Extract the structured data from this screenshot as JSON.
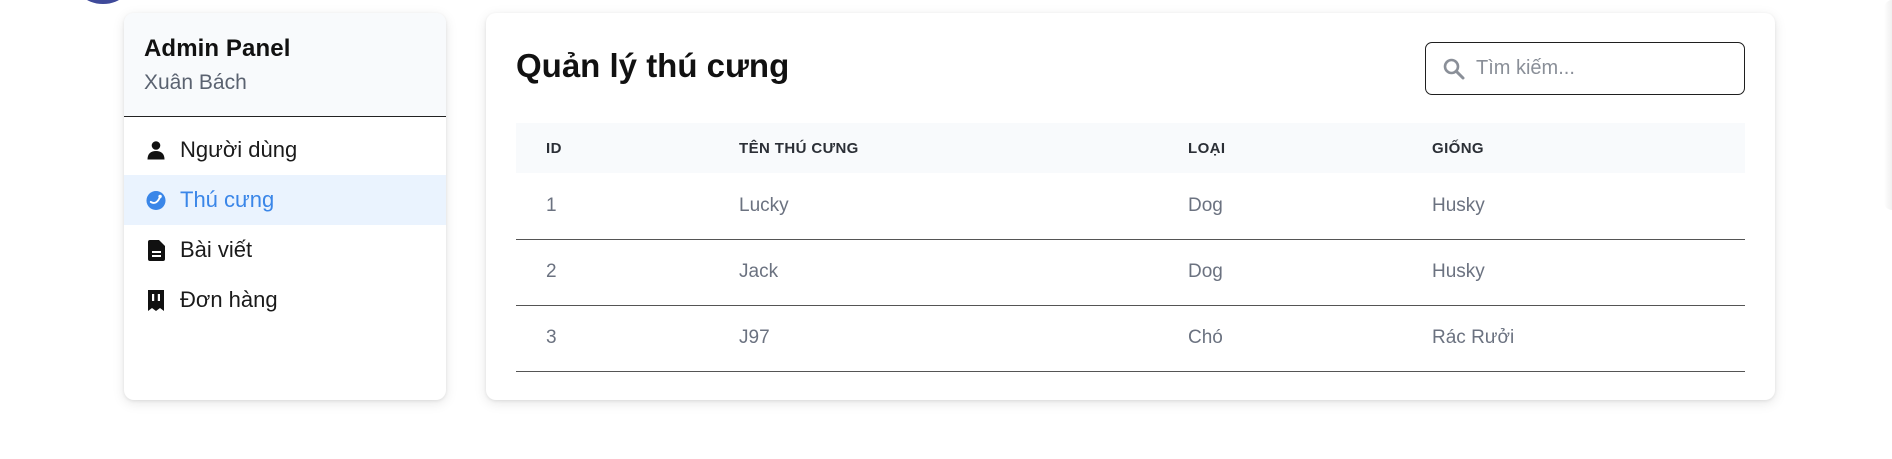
{
  "sidebar": {
    "title": "Admin Panel",
    "subtitle": "Xuân Bách",
    "items": [
      {
        "label": "Người dùng",
        "icon": "user-icon",
        "active": false
      },
      {
        "label": "Thú cưng",
        "icon": "pet-icon",
        "active": true
      },
      {
        "label": "Bài viết",
        "icon": "document-icon",
        "active": false
      },
      {
        "label": "Đơn hàng",
        "icon": "receipt-icon",
        "active": false
      }
    ]
  },
  "main": {
    "title": "Quản lý thú cưng",
    "search": {
      "placeholder": "Tìm kiếm...",
      "value": ""
    },
    "table": {
      "headers": [
        "ID",
        "TÊN THÚ CƯNG",
        "LOẠI",
        "GIỐNG"
      ],
      "rows": [
        [
          "1",
          "Lucky",
          "Dog",
          "Husky"
        ],
        [
          "2",
          "Jack",
          "Dog",
          "Husky"
        ],
        [
          "3",
          "J97",
          "Chó",
          "Rác Rưởi"
        ]
      ]
    }
  },
  "colors": {
    "accent": "#3a86e8",
    "active_bg": "#eaf3fe",
    "header_bg": "#f8fafc",
    "muted_text": "#6b7280"
  }
}
